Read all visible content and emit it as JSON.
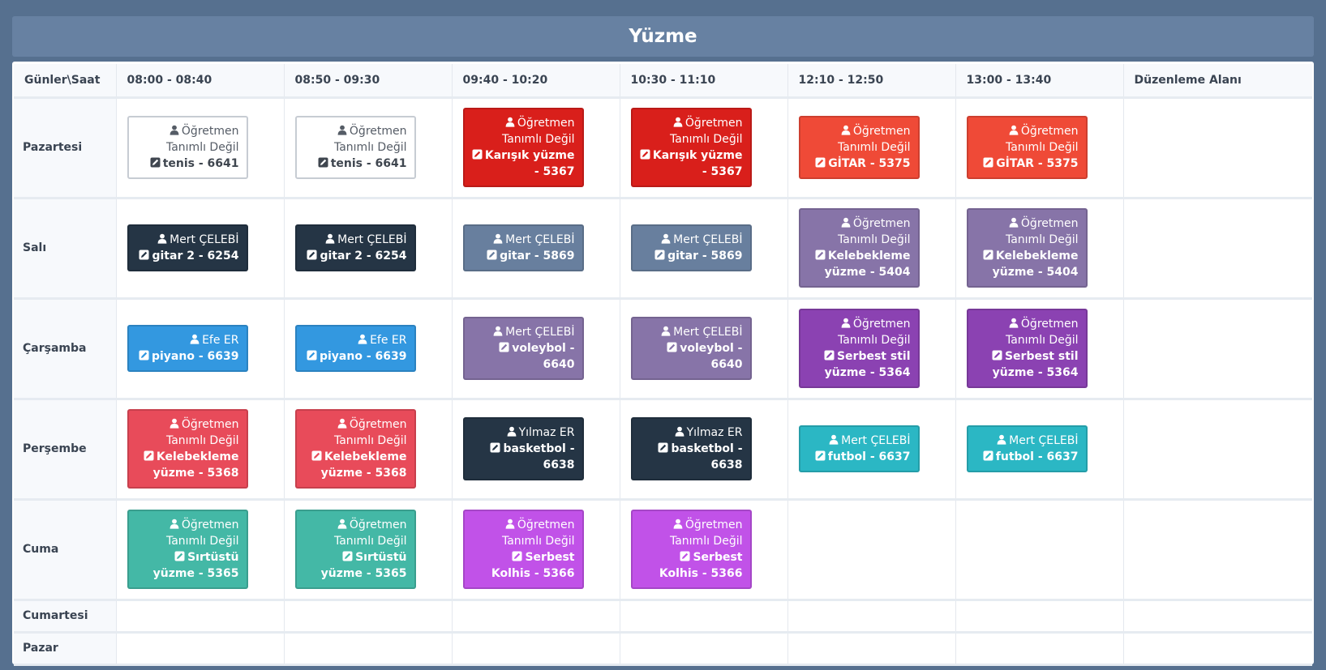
{
  "title": "Yüzme",
  "header": {
    "corner": "Günler\\Saat",
    "slots": [
      "08:00 - 08:40",
      "08:50 - 09:30",
      "09:40 - 10:20",
      "10:30 - 11:10",
      "12:10 - 12:50",
      "13:00 - 13:40"
    ],
    "edit_column": "Düzenleme Alanı"
  },
  "days": [
    {
      "name": "Pazartesi",
      "slots": [
        {
          "teacher": "Öğretmen Tanımlı Değil",
          "course": "tenis - 6641",
          "color": "#ffffff",
          "outline": true
        },
        {
          "teacher": "Öğretmen Tanımlı Değil",
          "course": "tenis - 6641",
          "color": "#ffffff",
          "outline": true
        },
        {
          "teacher": "Öğretmen Tanımlı Değil",
          "course": "Karışık yüzme - 5367",
          "color": "#d91f1b"
        },
        {
          "teacher": "Öğretmen Tanımlı Değil",
          "course": "Karışık yüzme - 5367",
          "color": "#d91f1b"
        },
        {
          "teacher": "Öğretmen Tanımlı Değil",
          "course": "GİTAR - 5375",
          "color": "#ef4a37"
        },
        {
          "teacher": "Öğretmen Tanımlı Değil",
          "course": "GİTAR - 5375",
          "color": "#ef4a37"
        }
      ]
    },
    {
      "name": "Salı",
      "slots": [
        {
          "teacher": "Mert ÇELEBİ",
          "course": "gitar 2 - 6254",
          "color": "#253545"
        },
        {
          "teacher": "Mert ÇELEBİ",
          "course": "gitar 2 - 6254",
          "color": "#253545"
        },
        {
          "teacher": "Mert ÇELEBİ",
          "course": "gitar - 5869",
          "color": "#687f9e"
        },
        {
          "teacher": "Mert ÇELEBİ",
          "course": "gitar - 5869",
          "color": "#687f9e"
        },
        {
          "teacher": "Öğretmen Tanımlı Değil",
          "course": "Kelebekleme yüzme - 5404",
          "color": "#8774a8"
        },
        {
          "teacher": "Öğretmen Tanımlı Değil",
          "course": "Kelebekleme yüzme - 5404",
          "color": "#8774a8"
        }
      ]
    },
    {
      "name": "Çarşamba",
      "slots": [
        {
          "teacher": "Efe ER",
          "course": "piyano - 6639",
          "color": "#3398e0"
        },
        {
          "teacher": "Efe ER",
          "course": "piyano - 6639",
          "color": "#3398e0"
        },
        {
          "teacher": "Mert ÇELEBİ",
          "course": "voleybol - 6640",
          "color": "#8774a8"
        },
        {
          "teacher": "Mert ÇELEBİ",
          "course": "voleybol - 6640",
          "color": "#8774a8"
        },
        {
          "teacher": "Öğretmen Tanımlı Değil",
          "course": "Serbest stil yüzme - 5364",
          "color": "#8b42b2"
        },
        {
          "teacher": "Öğretmen Tanımlı Değil",
          "course": "Serbest stil yüzme - 5364",
          "color": "#8b42b2"
        }
      ]
    },
    {
      "name": "Perşembe",
      "slots": [
        {
          "teacher": "Öğretmen Tanımlı Değil",
          "course": "Kelebekleme yüzme - 5368",
          "color": "#e84b5a"
        },
        {
          "teacher": "Öğretmen Tanımlı Değil",
          "course": "Kelebekleme yüzme - 5368",
          "color": "#e84b5a"
        },
        {
          "teacher": "Yılmaz ER",
          "course": "basketbol - 6638",
          "color": "#253545"
        },
        {
          "teacher": "Yılmaz ER",
          "course": "basketbol - 6638",
          "color": "#253545"
        },
        {
          "teacher": "Mert ÇELEBİ",
          "course": "futbol - 6637",
          "color": "#2bb7c4"
        },
        {
          "teacher": "Mert ÇELEBİ",
          "course": "futbol - 6637",
          "color": "#2bb7c4"
        }
      ]
    },
    {
      "name": "Cuma",
      "slots": [
        {
          "teacher": "Öğretmen Tanımlı Değil",
          "course": "Sırtüstü yüzme - 5365",
          "color": "#44b8a6"
        },
        {
          "teacher": "Öğretmen Tanımlı Değil",
          "course": "Sırtüstü yüzme - 5365",
          "color": "#44b8a6"
        },
        {
          "teacher": "Öğretmen Tanımlı Değil",
          "course": "Serbest Kolhis - 5366",
          "color": "#c152e8"
        },
        {
          "teacher": "Öğretmen Tanımlı Değil",
          "course": "Serbest Kolhis - 5366",
          "color": "#c152e8"
        },
        null,
        null
      ]
    },
    {
      "name": "Cumartesi",
      "slots": [
        null,
        null,
        null,
        null,
        null,
        null
      ]
    },
    {
      "name": "Pazar",
      "slots": [
        null,
        null,
        null,
        null,
        null,
        null
      ]
    }
  ],
  "icons": {
    "teacher": "user-icon",
    "course": "edit-icon"
  }
}
